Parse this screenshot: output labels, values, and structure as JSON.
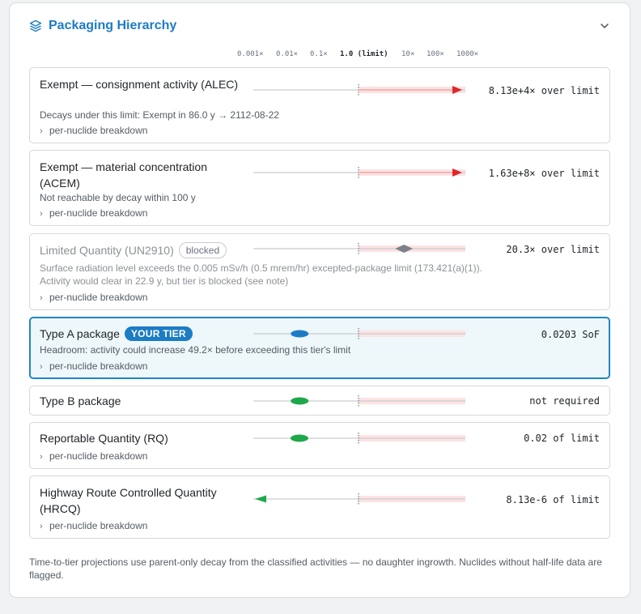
{
  "header": {
    "title": "Packaging Hierarchy",
    "icon": "layers-icon",
    "toggle_icon": "chevron-down-icon"
  },
  "scale": [
    "0.001×",
    "0.01×",
    "0.1×",
    "1.0 (limit)",
    "10×",
    "100×",
    "1000×"
  ],
  "tiers": [
    {
      "id": "alec",
      "name": "Exempt — consignment activity (ALEC)",
      "badge": "",
      "sub1": "Decays under this limit: Exempt in 86.0 y → 2112-08-22",
      "sub2": "",
      "breakdown": "per-nuclide breakdown",
      "result": "8.13e+4× over limit",
      "marker": "arrow-right",
      "ratio": 81300
    },
    {
      "id": "acem",
      "name": "Exempt — material concentration (ACEM)",
      "badge": "",
      "sub1": "Not reachable by decay within 100 y",
      "sub2": "",
      "breakdown": "per-nuclide breakdown",
      "result": "1.63e+8× over limit",
      "marker": "arrow-right",
      "ratio": 163000000
    },
    {
      "id": "lq",
      "name": "Limited Quantity (UN2910)",
      "badge": "blocked",
      "sub1": "Surface radiation level exceeds the 0.005 mSv/h (0.5 mrem/hr) excepted-package limit (173.421(a)(1)).",
      "sub2": "Activity would clear in 22.9 y, but tier is blocked (see note)",
      "breakdown": "per-nuclide breakdown",
      "result": "20.3× over limit",
      "marker": "diamond",
      "ratio": 20.3
    },
    {
      "id": "typea",
      "name": "Type A package",
      "badge": "YOUR TIER",
      "sub1": "Headroom: activity could increase 49.2× before exceeding this tier's limit",
      "sub2": "",
      "breakdown": "per-nuclide breakdown",
      "result": "0.0203 SoF",
      "marker": "dot-blue",
      "ratio": 0.0203
    },
    {
      "id": "typeb",
      "name": "Type B package",
      "badge": "",
      "sub1": "",
      "sub2": "",
      "breakdown": "",
      "result": "not required",
      "marker": "dot-green",
      "ratio": 0.0203
    },
    {
      "id": "rq",
      "name": "Reportable Quantity (RQ)",
      "badge": "",
      "sub1": "",
      "sub2": "",
      "breakdown": "per-nuclide breakdown",
      "result": "0.02 of limit",
      "marker": "dot-green",
      "ratio": 0.02
    },
    {
      "id": "hrcq",
      "name": "Highway Route Controlled Quantity (HRCQ)",
      "badge": "",
      "sub1": "",
      "sub2": "",
      "breakdown": "per-nuclide breakdown",
      "result": "8.13e-6 of limit",
      "marker": "arrow-left",
      "ratio": 8.13e-06
    }
  ],
  "colors": {
    "accent": "#1c7cc4",
    "red": "#e0262b",
    "green": "#1fa84a",
    "gray": "#7b8188",
    "limit_band": "#fde3e3"
  },
  "footer": "Time-to-tier projections use parent-only decay from the classified activities — no daughter ingrowth. Nuclides without half-life data are flagged."
}
